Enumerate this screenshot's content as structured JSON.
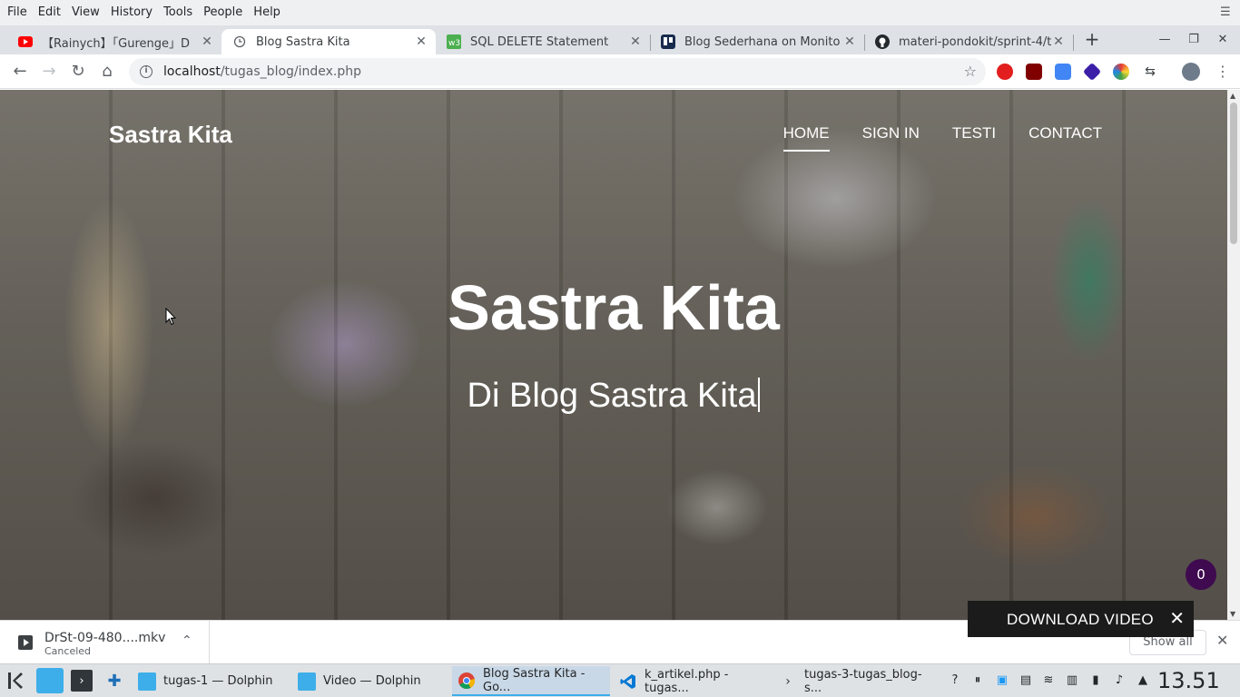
{
  "menubar": {
    "items": [
      "File",
      "Edit",
      "View",
      "History",
      "Tools",
      "People",
      "Help"
    ]
  },
  "tabs": [
    {
      "title": "【Rainych】「Gurenge」D",
      "favicon": "youtube-icon"
    },
    {
      "title": "Blog Sastra Kita",
      "favicon": "loading-icon"
    },
    {
      "title": "SQL DELETE Statement",
      "favicon": "w3schools-icon"
    },
    {
      "title": "Blog Sederhana on Monito",
      "favicon": "trello-icon"
    },
    {
      "title": "materi-pondokit/sprint-4/t",
      "favicon": "github-icon"
    }
  ],
  "address": {
    "host": "localhost",
    "path": "/tugas_blog/index.php"
  },
  "page": {
    "brand": "Sastra Kita",
    "nav": [
      "HOME",
      "SIGN IN",
      "TESTI",
      "CONTACT"
    ],
    "hero_title": "Sastra Kita",
    "hero_subtitle": "Di Blog Sastra Kita",
    "badge_count": "0"
  },
  "download_overlay": {
    "label": "DOWNLOAD VIDEO"
  },
  "downloads": {
    "item": {
      "name": "DrSt-09-480....mkv",
      "status": "Canceled"
    },
    "show_all": "Show all"
  },
  "taskbar": {
    "tasks": [
      {
        "label": "tugas-1 — Dolphin"
      },
      {
        "label": "Video — Dolphin"
      },
      {
        "label": "Blog Sastra Kita - Go..."
      },
      {
        "label": "k_artikel.php - tugas..."
      },
      {
        "label": "tugas-3-tugas_blog-s..."
      }
    ],
    "clock": "13.51"
  }
}
